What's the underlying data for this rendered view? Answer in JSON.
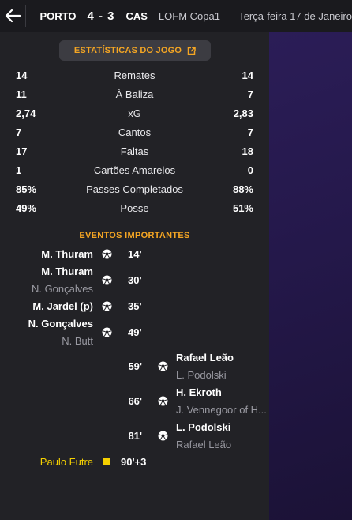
{
  "header": {
    "home_team": "PORTO",
    "score": "4 - 3",
    "away_team": "CAS",
    "competition": "LOFM Copa1",
    "date": "Terça-feira 17 de Janeiro"
  },
  "stats_button_label": "ESTATÍSTICAS DO JOGO",
  "stats": [
    {
      "label": "Remates",
      "home": "14",
      "away": "14"
    },
    {
      "label": "À Baliza",
      "home": "11",
      "away": "7"
    },
    {
      "label": "xG",
      "home": "2,74",
      "away": "2,83"
    },
    {
      "label": "Cantos",
      "home": "7",
      "away": "7"
    },
    {
      "label": "Faltas",
      "home": "17",
      "away": "18"
    },
    {
      "label": "Cartões Amarelos",
      "home": "1",
      "away": "0"
    },
    {
      "label": "Passes Completados",
      "home": "85%",
      "away": "88%"
    },
    {
      "label": "Posse",
      "home": "49%",
      "away": "51%"
    }
  ],
  "events_title": "EVENTOS IMPORTANTES",
  "events": [
    {
      "side": "home",
      "type": "goal",
      "player": "M. Thuram",
      "assist": "",
      "minute": "14'"
    },
    {
      "side": "home",
      "type": "goal",
      "player": "M. Thuram",
      "assist": "N. Gonçalves",
      "minute": "30'"
    },
    {
      "side": "home",
      "type": "goal",
      "player": "M. Jardel (p)",
      "assist": "",
      "minute": "35'"
    },
    {
      "side": "home",
      "type": "goal",
      "player": "N. Gonçalves",
      "assist": "N. Butt",
      "minute": "49'"
    },
    {
      "side": "away",
      "type": "goal",
      "player": "Rafael Leão",
      "assist": "L. Podolski",
      "minute": "59'"
    },
    {
      "side": "away",
      "type": "goal",
      "player": "H. Ekroth",
      "assist": "J. Vennegoor of H...",
      "minute": "66'"
    },
    {
      "side": "away",
      "type": "goal",
      "player": "L. Podolski",
      "assist": "Rafael Leão",
      "minute": "81'"
    },
    {
      "side": "home",
      "type": "yellow-card",
      "player": "Paulo Futre",
      "assist": "",
      "minute": "90'+3"
    }
  ],
  "colors": {
    "accent": "#f5a623",
    "yellow_card_name": "#f5d000",
    "panel_bg": "#222226",
    "pitch_bg": "#2b1d57"
  },
  "icons": [
    "back-arrow-icon",
    "external-link-icon",
    "football-icon",
    "yellow-card-icon"
  ]
}
